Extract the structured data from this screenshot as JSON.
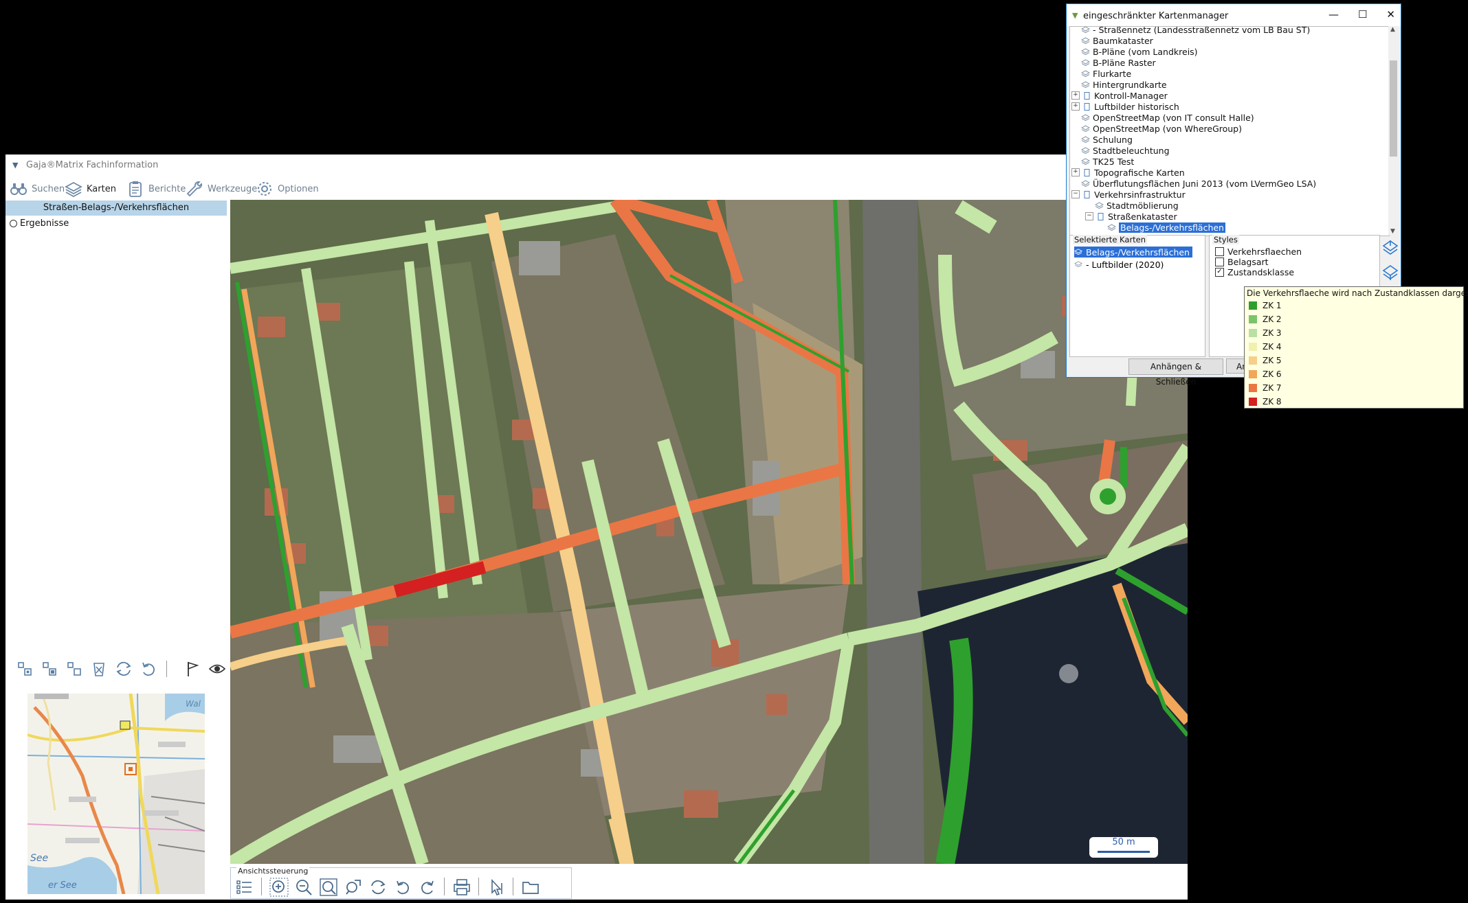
{
  "main": {
    "title": "Gaja®Matrix Fachinformation",
    "toolbar": [
      {
        "label": "Suchen",
        "icon": "binoculars-icon"
      },
      {
        "label": "Karten",
        "icon": "layers-icon"
      },
      {
        "label": "Berichte",
        "icon": "clipboard-icon"
      },
      {
        "label": "Werkzeuge",
        "icon": "wrench-icon"
      },
      {
        "label": "Optionen",
        "icon": "gear-icon"
      }
    ],
    "left_panel": {
      "header": "Straßen-Belags-/Verkehrsflächen",
      "item": "Ergebnisse"
    },
    "scale_label": "50 m",
    "view_control_label": "Ansichtssteuerung"
  },
  "minimap": {
    "label_see": "See",
    "label_bottom": "er See",
    "label_wal": "Wal"
  },
  "kartenmanager": {
    "title": "eingeschränkter Kartenmanager",
    "window_buttons": [
      "—",
      "☐",
      "✕"
    ],
    "tree": [
      {
        "label": "- Straßennetz (Landesstraßennetz vom LB Bau ST)",
        "level": 0,
        "type": "layer"
      },
      {
        "label": "Baumkataster",
        "level": 0,
        "type": "layer"
      },
      {
        "label": "B-Pläne (vom Landkreis)",
        "level": 0,
        "type": "layer"
      },
      {
        "label": "B-Pläne Raster",
        "level": 0,
        "type": "layer"
      },
      {
        "label": "Flurkarte",
        "level": 0,
        "type": "layer"
      },
      {
        "label": "Hintergrundkarte",
        "level": 0,
        "type": "layer"
      },
      {
        "label": "Kontroll-Manager",
        "level": 0,
        "type": "folder",
        "expand": "+"
      },
      {
        "label": "Luftbilder historisch",
        "level": 0,
        "type": "folder",
        "expand": "+"
      },
      {
        "label": "OpenStreetMap (von IT consult Halle)",
        "level": 0,
        "type": "layer"
      },
      {
        "label": "OpenStreetMap (von WhereGroup)",
        "level": 0,
        "type": "layer"
      },
      {
        "label": "Schulung",
        "level": 0,
        "type": "layer"
      },
      {
        "label": "Stadtbeleuchtung",
        "level": 0,
        "type": "layer"
      },
      {
        "label": "TK25 Test",
        "level": 0,
        "type": "layer"
      },
      {
        "label": "Topografische Karten",
        "level": 0,
        "type": "folder",
        "expand": "+"
      },
      {
        "label": "Überflutungsflächen Juni 2013 (vom LVermGeo LSA)",
        "level": 0,
        "type": "layer"
      },
      {
        "label": "Verkehrsinfrastruktur",
        "level": 0,
        "type": "folder",
        "expand": "−"
      },
      {
        "label": "Stadtmöblierung",
        "level": 1,
        "type": "layer"
      },
      {
        "label": "Straßenkataster",
        "level": 1,
        "type": "folder",
        "expand": "−"
      },
      {
        "label": "Belags-/Verkehrsflächen",
        "level": 2,
        "type": "layer",
        "selected": true
      }
    ],
    "selected_group": "Selektierte Karten",
    "selected_maps": [
      {
        "label": "Belags-/Verkehrsflächen",
        "selected": true
      },
      {
        "label": "- Luftbilder (2020)",
        "selected": false
      }
    ],
    "styles_group": "Styles",
    "styles": [
      {
        "label": "Verkehrsflaechen",
        "checked": false
      },
      {
        "label": "Belagsart",
        "checked": false
      },
      {
        "label": "Zustandsklasse",
        "checked": true
      }
    ],
    "btn_attach_close": "Anhängen & Schließen",
    "btn_second": "An"
  },
  "legend": {
    "header": "Die Verkehrsflaeche wird nach Zustandklassen dargestellt",
    "items": [
      {
        "label": "ZK 1",
        "color": "#2e9e2e"
      },
      {
        "label": "ZK 2",
        "color": "#7cc46a"
      },
      {
        "label": "ZK 3",
        "color": "#b9e0a4"
      },
      {
        "label": "ZK 4",
        "color": "#f0f0b0"
      },
      {
        "label": "ZK 5",
        "color": "#f6cf8a"
      },
      {
        "label": "ZK 6",
        "color": "#f2a65a"
      },
      {
        "label": "ZK 7",
        "color": "#ea7645"
      },
      {
        "label": "ZK 8",
        "color": "#d42020"
      }
    ]
  }
}
